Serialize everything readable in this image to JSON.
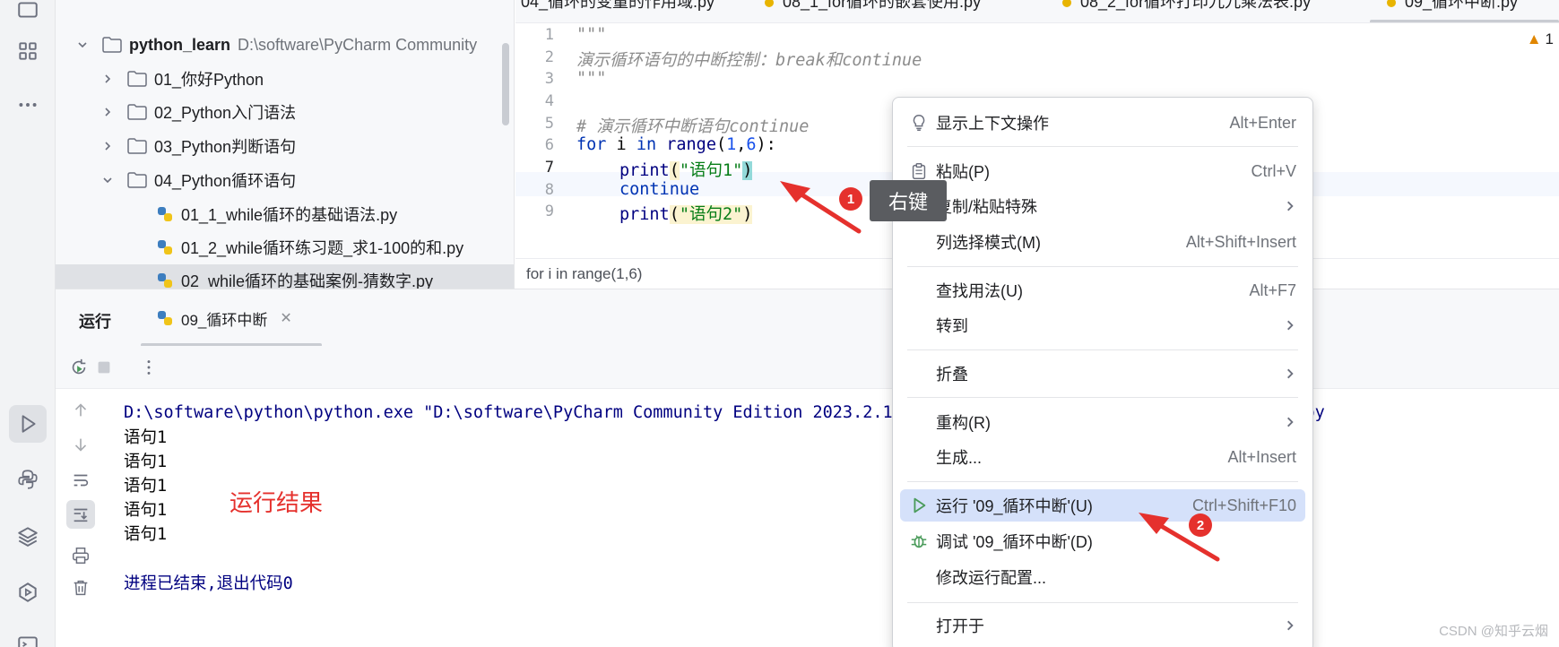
{
  "project": {
    "root_name": "python_learn",
    "root_path": "D:\\software\\PyCharm Community",
    "items": [
      {
        "label": "01_你好Python",
        "kind": "folder"
      },
      {
        "label": "02_Python入门语法",
        "kind": "folder"
      },
      {
        "label": "03_Python判断语句",
        "kind": "folder"
      },
      {
        "label": "04_Python循环语句",
        "kind": "folder"
      },
      {
        "label": "01_1_while循环的基础语法.py",
        "kind": "file"
      },
      {
        "label": "01_2_while循环练习题_求1-100的和.py",
        "kind": "file"
      },
      {
        "label": "02_while循环的基础案例-猜数字.py",
        "kind": "file"
      }
    ]
  },
  "editor": {
    "tabs": [
      "04_循环的变量的作用域.py",
      "08_1_for循环的嵌套使用.py",
      "08_2_for循环打印九九乘法表.py",
      "09_循环中断.py"
    ],
    "line_numbers": [
      "1",
      "2",
      "3",
      "4",
      "5",
      "6",
      "7",
      "8",
      "9"
    ],
    "code": {
      "l1": "\"\"\"",
      "l2": "演示循环语句的中断控制：break和continue",
      "l3": "\"\"\"",
      "l5": "# 演示循环中断语句continue",
      "l6_kw_for": "for",
      "l6_var": " i ",
      "l6_kw_in": "in",
      "l6_fn": " range",
      "l6_open": "(",
      "l6_n1": "1",
      "l6_comma": ",",
      "l6_n2": "6",
      "l6_close": "):",
      "l7_fn": "print",
      "l7_open": "(",
      "l7_str": "\"语句1\"",
      "l7_close": ")",
      "l8_kw": "continue",
      "l9_fn": "print",
      "l9_open": "(",
      "l9_str": "\"语句2\"",
      "l9_close": ")"
    },
    "warning_count": "1"
  },
  "breadcrumb": "for i in range(1,6)",
  "run_panel": {
    "title": "运行",
    "tab_label": "09_循环中断",
    "console": {
      "command": "D:\\software\\python\\python.exe \"D:\\software\\PyCharm Community Edition 2023.2.1\\python_learn\\04_Python循环语句\\09_循环中断.py",
      "outputs": [
        "语句1",
        "语句1",
        "语句1",
        "语句1",
        "语句1"
      ],
      "exit_message": "进程已结束,退出代码0"
    },
    "result_note": "运行结果"
  },
  "context_menu": {
    "items": [
      {
        "label": "显示上下文操作",
        "shortcut": "Alt+Enter"
      },
      {
        "label": "粘贴(P)",
        "shortcut": "Ctrl+V"
      },
      {
        "label": "复制/粘贴特殊",
        "shortcut": ""
      },
      {
        "label": "列选择模式(M)",
        "shortcut": "Alt+Shift+Insert"
      },
      {
        "label": "查找用法(U)",
        "shortcut": "Alt+F7"
      },
      {
        "label": "转到",
        "shortcut": ""
      },
      {
        "label": "折叠",
        "shortcut": ""
      },
      {
        "label": "重构(R)",
        "shortcut": ""
      },
      {
        "label": "生成...",
        "shortcut": "Alt+Insert"
      },
      {
        "label": "运行 '09_循环中断'(U)",
        "shortcut": "Ctrl+Shift+F10"
      },
      {
        "label": "调试 '09_循环中断'(D)",
        "shortcut": ""
      },
      {
        "label": "修改运行配置...",
        "shortcut": ""
      },
      {
        "label": "打开于",
        "shortcut": ""
      }
    ]
  },
  "annotations": {
    "badge1": "1",
    "badge2": "2",
    "right_click_tip": "右键"
  },
  "watermark": "CSDN @知乎云烟",
  "colors": {
    "accent_selection": "#d5e1fa",
    "annotation_red": "#e5312d",
    "keyword": "#0033b3",
    "string": "#067d17",
    "number": "#1750eb"
  }
}
